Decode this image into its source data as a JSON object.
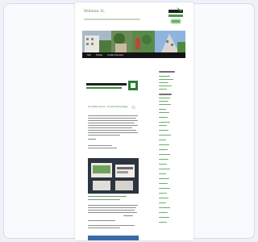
{
  "site": {
    "title": "Wohnen 1L",
    "nav_items": [
      "Start",
      "Projekte",
      "Kontakt Impressum"
    ]
  },
  "colors": {
    "accent": "#54904f",
    "link": "#3d8a3d",
    "nav": "#131313",
    "background": "#eef1f7"
  },
  "post": {
    "title": "Immobilien News – Projekt Wohnanlage"
  }
}
